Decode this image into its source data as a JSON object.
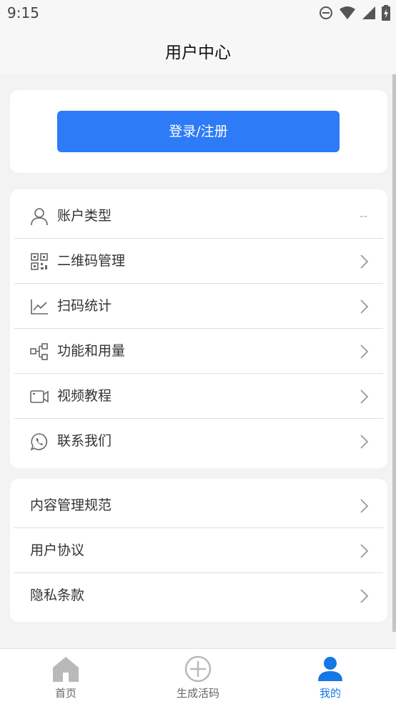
{
  "status_bar": {
    "time": "9:15",
    "icons": [
      "dnd-icon",
      "wifi-icon",
      "signal-icon",
      "battery-charging-icon"
    ]
  },
  "header": {
    "title": "用户中心"
  },
  "login": {
    "button_label": "登录/注册"
  },
  "menu": {
    "items": [
      {
        "label": "账户类型",
        "icon": "user-icon",
        "value": "--"
      },
      {
        "label": "二维码管理",
        "icon": "qrcode-icon"
      },
      {
        "label": "扫码统计",
        "icon": "line-chart-icon"
      },
      {
        "label": "功能和用量",
        "icon": "feature-tree-icon"
      },
      {
        "label": "视频教程",
        "icon": "video-camera-icon"
      },
      {
        "label": "联系我们",
        "icon": "whatsapp-icon"
      }
    ]
  },
  "policies": {
    "items": [
      {
        "label": "内容管理规范"
      },
      {
        "label": "用户协议"
      },
      {
        "label": "隐私条款"
      }
    ]
  },
  "tabbar": {
    "tabs": [
      {
        "label": "首页",
        "icon": "home-icon",
        "active": false
      },
      {
        "label": "生成活码",
        "icon": "add-circle-icon",
        "active": false
      },
      {
        "label": "我的",
        "icon": "profile-icon",
        "active": true
      }
    ],
    "active_color": "#1677e6",
    "inactive_color": "#666666"
  },
  "colors": {
    "primary": "#2d7bf6",
    "background": "#f3f3f3"
  }
}
